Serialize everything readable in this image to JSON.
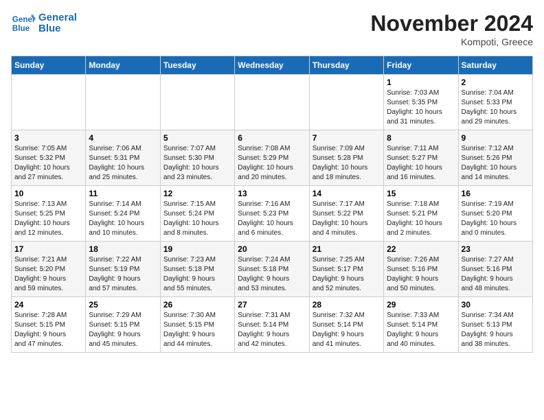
{
  "header": {
    "logo_line1": "General",
    "logo_line2": "Blue",
    "month_year": "November 2024",
    "location": "Kompoti, Greece"
  },
  "weekdays": [
    "Sunday",
    "Monday",
    "Tuesday",
    "Wednesday",
    "Thursday",
    "Friday",
    "Saturday"
  ],
  "weeks": [
    [
      {
        "day": "",
        "info": ""
      },
      {
        "day": "",
        "info": ""
      },
      {
        "day": "",
        "info": ""
      },
      {
        "day": "",
        "info": ""
      },
      {
        "day": "",
        "info": ""
      },
      {
        "day": "1",
        "info": "Sunrise: 7:03 AM\nSunset: 5:35 PM\nDaylight: 10 hours\nand 31 minutes."
      },
      {
        "day": "2",
        "info": "Sunrise: 7:04 AM\nSunset: 5:33 PM\nDaylight: 10 hours\nand 29 minutes."
      }
    ],
    [
      {
        "day": "3",
        "info": "Sunrise: 7:05 AM\nSunset: 5:32 PM\nDaylight: 10 hours\nand 27 minutes."
      },
      {
        "day": "4",
        "info": "Sunrise: 7:06 AM\nSunset: 5:31 PM\nDaylight: 10 hours\nand 25 minutes."
      },
      {
        "day": "5",
        "info": "Sunrise: 7:07 AM\nSunset: 5:30 PM\nDaylight: 10 hours\nand 23 minutes."
      },
      {
        "day": "6",
        "info": "Sunrise: 7:08 AM\nSunset: 5:29 PM\nDaylight: 10 hours\nand 20 minutes."
      },
      {
        "day": "7",
        "info": "Sunrise: 7:09 AM\nSunset: 5:28 PM\nDaylight: 10 hours\nand 18 minutes."
      },
      {
        "day": "8",
        "info": "Sunrise: 7:11 AM\nSunset: 5:27 PM\nDaylight: 10 hours\nand 16 minutes."
      },
      {
        "day": "9",
        "info": "Sunrise: 7:12 AM\nSunset: 5:26 PM\nDaylight: 10 hours\nand 14 minutes."
      }
    ],
    [
      {
        "day": "10",
        "info": "Sunrise: 7:13 AM\nSunset: 5:25 PM\nDaylight: 10 hours\nand 12 minutes."
      },
      {
        "day": "11",
        "info": "Sunrise: 7:14 AM\nSunset: 5:24 PM\nDaylight: 10 hours\nand 10 minutes."
      },
      {
        "day": "12",
        "info": "Sunrise: 7:15 AM\nSunset: 5:24 PM\nDaylight: 10 hours\nand 8 minutes."
      },
      {
        "day": "13",
        "info": "Sunrise: 7:16 AM\nSunset: 5:23 PM\nDaylight: 10 hours\nand 6 minutes."
      },
      {
        "day": "14",
        "info": "Sunrise: 7:17 AM\nSunset: 5:22 PM\nDaylight: 10 hours\nand 4 minutes."
      },
      {
        "day": "15",
        "info": "Sunrise: 7:18 AM\nSunset: 5:21 PM\nDaylight: 10 hours\nand 2 minutes."
      },
      {
        "day": "16",
        "info": "Sunrise: 7:19 AM\nSunset: 5:20 PM\nDaylight: 10 hours\nand 0 minutes."
      }
    ],
    [
      {
        "day": "17",
        "info": "Sunrise: 7:21 AM\nSunset: 5:20 PM\nDaylight: 9 hours\nand 59 minutes."
      },
      {
        "day": "18",
        "info": "Sunrise: 7:22 AM\nSunset: 5:19 PM\nDaylight: 9 hours\nand 57 minutes."
      },
      {
        "day": "19",
        "info": "Sunrise: 7:23 AM\nSunset: 5:18 PM\nDaylight: 9 hours\nand 55 minutes."
      },
      {
        "day": "20",
        "info": "Sunrise: 7:24 AM\nSunset: 5:18 PM\nDaylight: 9 hours\nand 53 minutes."
      },
      {
        "day": "21",
        "info": "Sunrise: 7:25 AM\nSunset: 5:17 PM\nDaylight: 9 hours\nand 52 minutes."
      },
      {
        "day": "22",
        "info": "Sunrise: 7:26 AM\nSunset: 5:16 PM\nDaylight: 9 hours\nand 50 minutes."
      },
      {
        "day": "23",
        "info": "Sunrise: 7:27 AM\nSunset: 5:16 PM\nDaylight: 9 hours\nand 48 minutes."
      }
    ],
    [
      {
        "day": "24",
        "info": "Sunrise: 7:28 AM\nSunset: 5:15 PM\nDaylight: 9 hours\nand 47 minutes."
      },
      {
        "day": "25",
        "info": "Sunrise: 7:29 AM\nSunset: 5:15 PM\nDaylight: 9 hours\nand 45 minutes."
      },
      {
        "day": "26",
        "info": "Sunrise: 7:30 AM\nSunset: 5:15 PM\nDaylight: 9 hours\nand 44 minutes."
      },
      {
        "day": "27",
        "info": "Sunrise: 7:31 AM\nSunset: 5:14 PM\nDaylight: 9 hours\nand 42 minutes."
      },
      {
        "day": "28",
        "info": "Sunrise: 7:32 AM\nSunset: 5:14 PM\nDaylight: 9 hours\nand 41 minutes."
      },
      {
        "day": "29",
        "info": "Sunrise: 7:33 AM\nSunset: 5:14 PM\nDaylight: 9 hours\nand 40 minutes."
      },
      {
        "day": "30",
        "info": "Sunrise: 7:34 AM\nSunset: 5:13 PM\nDaylight: 9 hours\nand 38 minutes."
      }
    ]
  ]
}
